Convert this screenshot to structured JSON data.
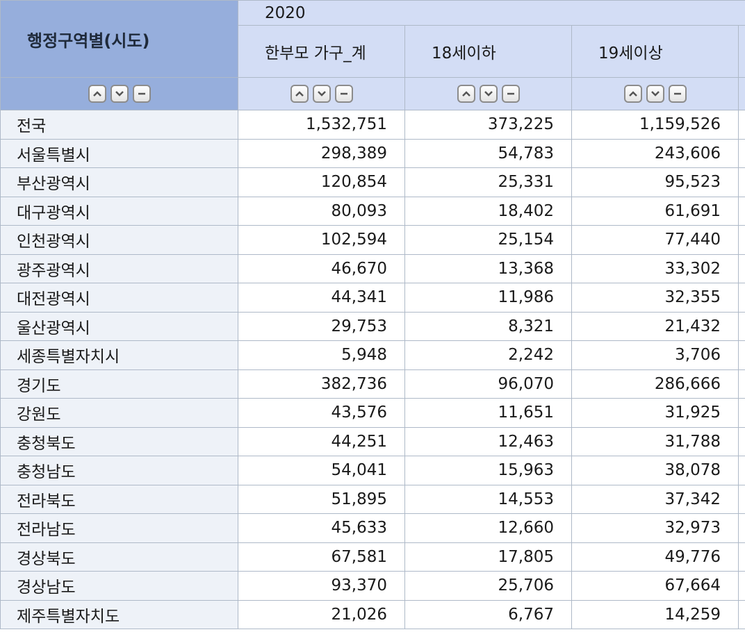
{
  "header": {
    "stub_label": "행정구역별(시도)",
    "year": "2020",
    "columns": [
      "한부모 가구_계",
      "18세이하",
      "19세이상"
    ]
  },
  "controls": {
    "up_icon": "chevron-up-icon",
    "down_icon": "chevron-down-icon",
    "remove_icon": "minus-icon"
  },
  "rows": [
    {
      "region": "전국",
      "values": [
        "1,532,751",
        "373,225",
        "1,159,526"
      ]
    },
    {
      "region": "서울특별시",
      "values": [
        "298,389",
        "54,783",
        "243,606"
      ]
    },
    {
      "region": "부산광역시",
      "values": [
        "120,854",
        "25,331",
        "95,523"
      ]
    },
    {
      "region": "대구광역시",
      "values": [
        "80,093",
        "18,402",
        "61,691"
      ]
    },
    {
      "region": "인천광역시",
      "values": [
        "102,594",
        "25,154",
        "77,440"
      ]
    },
    {
      "region": "광주광역시",
      "values": [
        "46,670",
        "13,368",
        "33,302"
      ]
    },
    {
      "region": "대전광역시",
      "values": [
        "44,341",
        "11,986",
        "32,355"
      ]
    },
    {
      "region": "울산광역시",
      "values": [
        "29,753",
        "8,321",
        "21,432"
      ]
    },
    {
      "region": "세종특별자치시",
      "values": [
        "5,948",
        "2,242",
        "3,706"
      ]
    },
    {
      "region": "경기도",
      "values": [
        "382,736",
        "96,070",
        "286,666"
      ]
    },
    {
      "region": "강원도",
      "values": [
        "43,576",
        "11,651",
        "31,925"
      ]
    },
    {
      "region": "충청북도",
      "values": [
        "44,251",
        "12,463",
        "31,788"
      ]
    },
    {
      "region": "충청남도",
      "values": [
        "54,041",
        "15,963",
        "38,078"
      ]
    },
    {
      "region": "전라북도",
      "values": [
        "51,895",
        "14,553",
        "37,342"
      ]
    },
    {
      "region": "전라남도",
      "values": [
        "45,633",
        "12,660",
        "32,973"
      ]
    },
    {
      "region": "경상북도",
      "values": [
        "67,581",
        "17,805",
        "49,776"
      ]
    },
    {
      "region": "경상남도",
      "values": [
        "93,370",
        "25,706",
        "67,664"
      ]
    },
    {
      "region": "제주특별자치도",
      "values": [
        "21,026",
        "6,767",
        "14,259"
      ]
    }
  ]
}
